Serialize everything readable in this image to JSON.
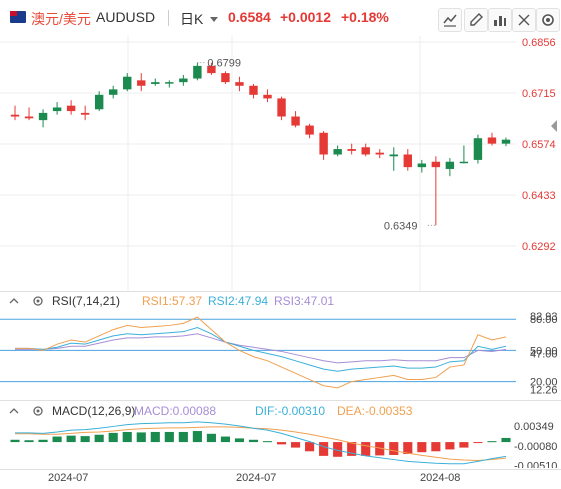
{
  "header": {
    "name": "澳元/美元",
    "code": "AUDUSD",
    "timeframe": "日K",
    "price": "0.6584",
    "change": "+0.0012",
    "change_pct": "+0.18%"
  },
  "tools": [
    "chart-type-icon",
    "draw-icon",
    "indicator-icon",
    "fullscreen-icon",
    "settings-icon"
  ],
  "colors": {
    "up": "#e53935",
    "down": "#1a8a4f",
    "grid": "#eeeeee"
  },
  "main_chart": {
    "price_axis": [
      "0.6856",
      "0.6715",
      "0.6574",
      "0.6433",
      "0.6292"
    ],
    "high_label": "0.6799",
    "low_label": "0.6349",
    "candles": [
      {
        "o": 0.6655,
        "h": 0.668,
        "l": 0.664,
        "c": 0.665
      },
      {
        "o": 0.665,
        "h": 0.6675,
        "l": 0.664,
        "c": 0.6645
      },
      {
        "o": 0.664,
        "h": 0.667,
        "l": 0.662,
        "c": 0.666
      },
      {
        "o": 0.6665,
        "h": 0.669,
        "l": 0.6655,
        "c": 0.6675
      },
      {
        "o": 0.668,
        "h": 0.6695,
        "l": 0.6655,
        "c": 0.6665
      },
      {
        "o": 0.666,
        "h": 0.668,
        "l": 0.664,
        "c": 0.6655
      },
      {
        "o": 0.667,
        "h": 0.672,
        "l": 0.6665,
        "c": 0.671
      },
      {
        "o": 0.671,
        "h": 0.6735,
        "l": 0.67,
        "c": 0.6725
      },
      {
        "o": 0.6725,
        "h": 0.677,
        "l": 0.672,
        "c": 0.676
      },
      {
        "o": 0.675,
        "h": 0.677,
        "l": 0.672,
        "c": 0.6735
      },
      {
        "o": 0.674,
        "h": 0.6755,
        "l": 0.6735,
        "c": 0.6745
      },
      {
        "o": 0.6742,
        "h": 0.675,
        "l": 0.673,
        "c": 0.6745
      },
      {
        "o": 0.6745,
        "h": 0.6765,
        "l": 0.6735,
        "c": 0.6755
      },
      {
        "o": 0.6755,
        "h": 0.6799,
        "l": 0.675,
        "c": 0.679
      },
      {
        "o": 0.679,
        "h": 0.6799,
        "l": 0.6765,
        "c": 0.677
      },
      {
        "o": 0.677,
        "h": 0.6775,
        "l": 0.674,
        "c": 0.6745
      },
      {
        "o": 0.6745,
        "h": 0.676,
        "l": 0.672,
        "c": 0.6735
      },
      {
        "o": 0.6735,
        "h": 0.674,
        "l": 0.67,
        "c": 0.671
      },
      {
        "o": 0.671,
        "h": 0.6725,
        "l": 0.669,
        "c": 0.67
      },
      {
        "o": 0.67,
        "h": 0.6705,
        "l": 0.664,
        "c": 0.665
      },
      {
        "o": 0.665,
        "h": 0.6665,
        "l": 0.662,
        "c": 0.6625
      },
      {
        "o": 0.6625,
        "h": 0.663,
        "l": 0.659,
        "c": 0.66
      },
      {
        "o": 0.6605,
        "h": 0.661,
        "l": 0.653,
        "c": 0.6545
      },
      {
        "o": 0.6545,
        "h": 0.657,
        "l": 0.654,
        "c": 0.656
      },
      {
        "o": 0.656,
        "h": 0.6575,
        "l": 0.6545,
        "c": 0.6555
      },
      {
        "o": 0.6565,
        "h": 0.6575,
        "l": 0.654,
        "c": 0.6545
      },
      {
        "o": 0.655,
        "h": 0.656,
        "l": 0.6535,
        "c": 0.6545
      },
      {
        "o": 0.654,
        "h": 0.6565,
        "l": 0.65,
        "c": 0.6545
      },
      {
        "o": 0.6545,
        "h": 0.656,
        "l": 0.65,
        "c": 0.651
      },
      {
        "o": 0.651,
        "h": 0.653,
        "l": 0.6495,
        "c": 0.652
      },
      {
        "o": 0.6525,
        "h": 0.654,
        "l": 0.6349,
        "c": 0.651
      },
      {
        "o": 0.6505,
        "h": 0.6535,
        "l": 0.6485,
        "c": 0.6525
      },
      {
        "o": 0.6525,
        "h": 0.657,
        "l": 0.652,
        "c": 0.6525
      },
      {
        "o": 0.653,
        "h": 0.66,
        "l": 0.652,
        "c": 0.659
      },
      {
        "o": 0.6592,
        "h": 0.6605,
        "l": 0.657,
        "c": 0.6575
      },
      {
        "o": 0.6575,
        "h": 0.6592,
        "l": 0.6568,
        "c": 0.6586
      }
    ]
  },
  "rsi": {
    "title": "RSI(7,14,21)",
    "rsi1": "RSI1:57.37",
    "rsi2": "RSI2:47.94",
    "rsi3": "RSI3:47.01",
    "axis": [
      "80.00",
      "82.93",
      "50.00",
      "47.00",
      "20.00",
      "12.26"
    ],
    "rsi1_values": [
      52,
      52,
      50,
      56,
      60,
      58,
      64,
      70,
      74,
      72,
      73,
      74,
      76,
      82,
      70,
      58,
      50,
      44,
      40,
      34,
      28,
      22,
      16,
      14,
      20,
      22,
      24,
      26,
      22,
      22,
      24,
      34,
      36,
      65,
      60,
      63
    ],
    "rsi2_values": [
      52,
      52,
      51,
      53,
      57,
      56,
      60,
      64,
      66,
      65,
      66,
      67,
      68,
      72,
      66,
      58,
      54,
      50,
      47,
      44,
      40,
      36,
      32,
      30,
      32,
      33,
      34,
      35,
      33,
      33,
      34,
      39,
      40,
      54,
      51,
      54
    ],
    "rsi3_values": [
      51,
      51,
      51,
      52,
      54,
      54,
      57,
      60,
      62,
      62,
      63,
      63,
      64,
      66,
      62,
      58,
      55,
      53,
      51,
      49,
      46,
      43,
      40,
      38,
      39,
      40,
      40,
      41,
      40,
      40,
      40,
      43,
      43,
      50,
      49,
      51
    ],
    "colors": {
      "rsi1": "#f0a050",
      "rsi2": "#3bb0d8",
      "rsi3": "#a68dd6"
    }
  },
  "macd": {
    "title": "MACD(12,26,9)",
    "macd_label": "MACD:0.00088",
    "dif_label": "DIF:-0.00310",
    "dea_label": "DEA:-0.00353",
    "axis": [
      "0.00349",
      "-0.00080",
      "-0.00510"
    ],
    "hist": [
      0.0005,
      0.0004,
      0.0005,
      0.0012,
      0.0014,
      0.0013,
      0.0016,
      0.002,
      0.0022,
      0.0021,
      0.0022,
      0.0022,
      0.0022,
      0.0024,
      0.0018,
      0.0012,
      0.0008,
      0.0005,
      0.0002,
      -0.0005,
      -0.0012,
      -0.002,
      -0.003,
      -0.0032,
      -0.003,
      -0.003,
      -0.0029,
      -0.0028,
      -0.0026,
      -0.0022,
      -0.002,
      -0.0016,
      -0.0012,
      -0.0002,
      0.0002,
      0.0009
    ],
    "dif": [
      0.002,
      0.002,
      0.0019,
      0.0022,
      0.0026,
      0.0027,
      0.003,
      0.0034,
      0.0038,
      0.004,
      0.0041,
      0.0042,
      0.0042,
      0.0044,
      0.0042,
      0.0039,
      0.0035,
      0.003,
      0.0026,
      0.0019,
      0.001,
      0.0001,
      -0.001,
      -0.0018,
      -0.0024,
      -0.003,
      -0.0034,
      -0.0038,
      -0.0042,
      -0.0044,
      -0.0046,
      -0.0047,
      -0.0047,
      -0.0042,
      -0.0036,
      -0.0031
    ],
    "dea": [
      0.0018,
      0.0018,
      0.0017,
      0.0017,
      0.0019,
      0.0021,
      0.0022,
      0.0024,
      0.0027,
      0.0029,
      0.003,
      0.0031,
      0.0031,
      0.0032,
      0.0033,
      0.0033,
      0.0032,
      0.003,
      0.0029,
      0.0026,
      0.0022,
      0.0017,
      0.0011,
      0.0005,
      -0.0002,
      -0.0008,
      -0.0013,
      -0.0019,
      -0.0024,
      -0.0029,
      -0.0033,
      -0.0037,
      -0.0039,
      -0.004,
      -0.0038,
      -0.0035
    ],
    "colors": {
      "dif": "#3bb0d8",
      "dea": "#f0a050"
    }
  },
  "time_axis": [
    "2024-07",
    "2024-07",
    "2024-08"
  ]
}
